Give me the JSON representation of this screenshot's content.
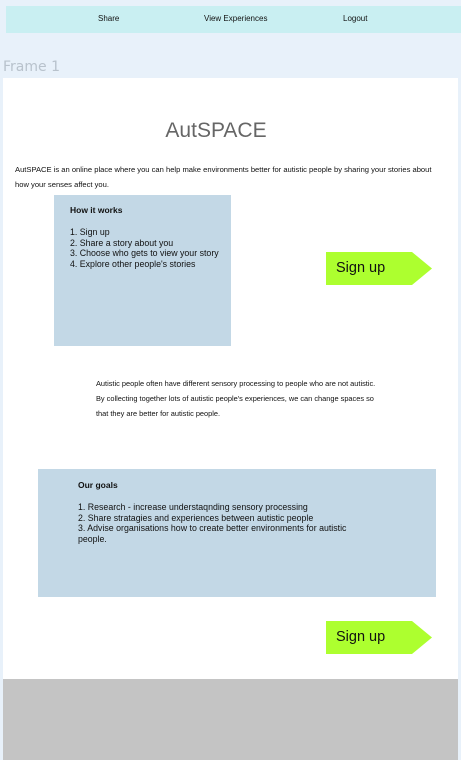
{
  "nav": {
    "share": "Share",
    "view_experiences": "View Experiences",
    "logout": "Logout"
  },
  "frame_label": "Frame 1",
  "page": {
    "title": "AutSPACE",
    "intro": "AutSPACE is an online place where you can help make environments better for autistic people by sharing your stories about how your senses affect you.",
    "how_it_works": {
      "heading": "How it works",
      "steps": [
        "1. Sign up",
        "2. Share a story about you",
        "3. Choose who gets to view your story",
        "4. Explore other people's stories"
      ]
    },
    "signup_label": "Sign up",
    "middle_text": "Autistic people often have different sensory processing to people who are not autistic. By collecting together lots of autistic people's experiences, we can change spaces so that they are better for autistic people.",
    "goals": {
      "heading": "Our goals",
      "items": [
        "1. Research - increase understaqnding sensory processing",
        "2. Share stratagies and experiences between autistic people",
        "3. Advise organisations how to create better environments for autistic people."
      ]
    },
    "signup_label_2": "Sign up"
  },
  "colors": {
    "navbar": "#c9eff2",
    "card": "#c3d8e6",
    "signup": "#adff2f",
    "footer": "#c4c4c4",
    "background": "#e8f1fa"
  }
}
